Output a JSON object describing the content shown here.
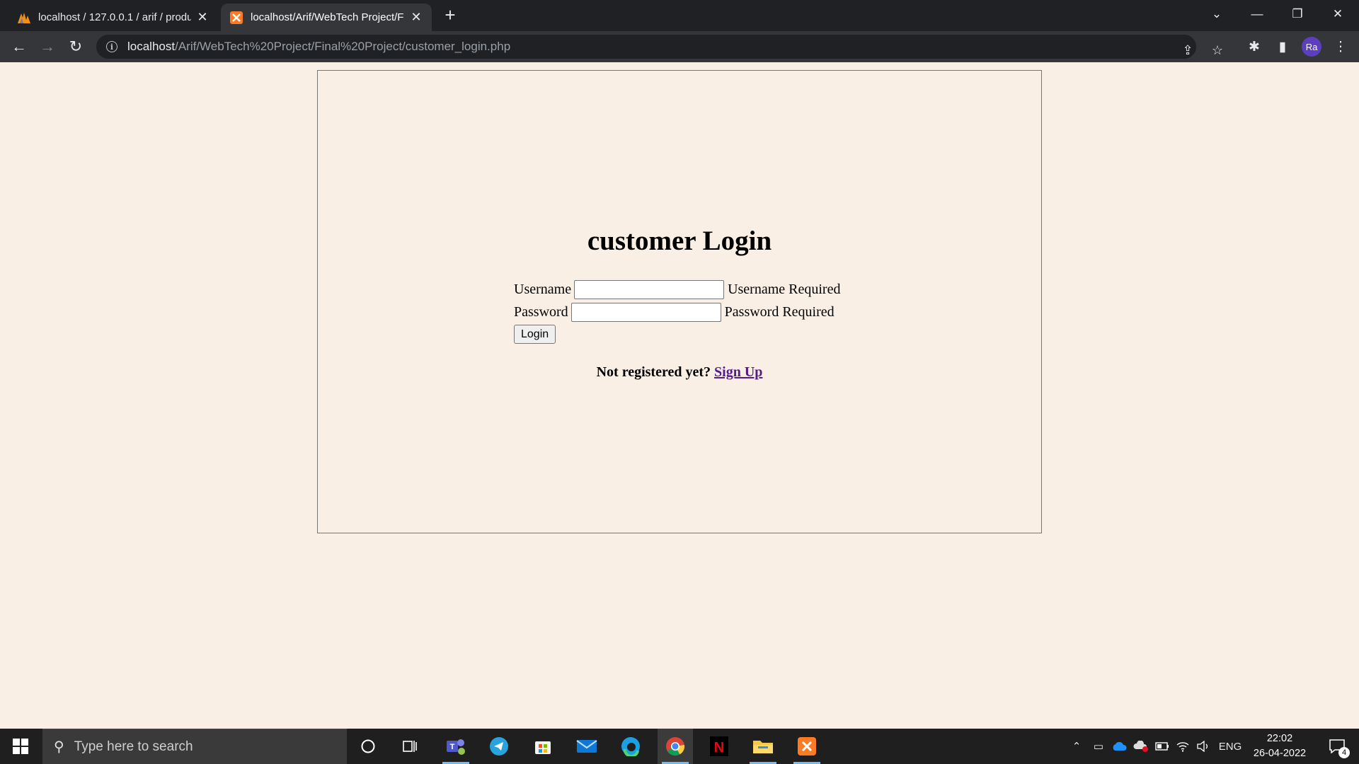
{
  "browser": {
    "tabs": [
      {
        "title": "localhost / 127.0.0.1 / arif / produ",
        "icon": "phpmyadmin-icon",
        "active": false
      },
      {
        "title": "localhost/Arif/WebTech Project/F",
        "icon": "xampp-icon",
        "active": true
      }
    ],
    "url": {
      "host": "localhost",
      "path": "/Arif/WebTech%20Project/Final%20Project/customer_login.php"
    },
    "profile_initials": "Ra"
  },
  "page": {
    "heading": "customer Login",
    "username_label": "Username",
    "username_value": "",
    "username_error": "Username Required",
    "password_label": "Password",
    "password_value": "",
    "password_error": "Password Required",
    "login_button": "Login",
    "signup_prompt": "Not registered yet?",
    "signup_link": "Sign Up"
  },
  "taskbar": {
    "search_placeholder": "Type here to search",
    "language": "ENG",
    "time": "22:02",
    "date": "26-04-2022",
    "notification_count": "4"
  },
  "colors": {
    "page_background": "#faefe5",
    "link": "#551a8b",
    "chrome_dark": "#202124",
    "chrome_toolbar": "#35363a"
  }
}
